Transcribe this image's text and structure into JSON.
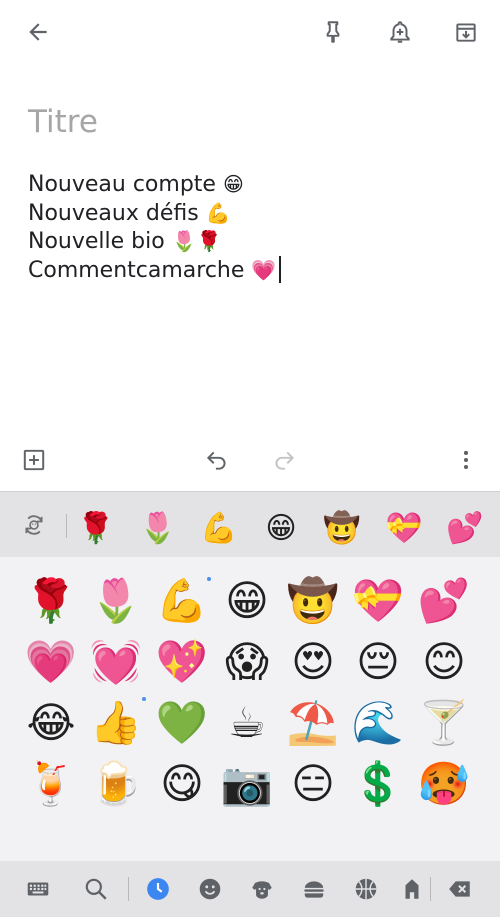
{
  "title_placeholder": "Titre",
  "note_lines": [
    {
      "text": "Nouveau compte",
      "emoji": "😁"
    },
    {
      "text": "Nouveaux défis",
      "emoji": "💪"
    },
    {
      "text": "Nouvelle bio",
      "emoji": "🌷🌹"
    },
    {
      "text": "Commentcamarche",
      "emoji": "💗"
    }
  ],
  "recent_emojis": [
    "🌹",
    "🌷",
    "💪",
    "😁",
    "🤠",
    "💝",
    "💕"
  ],
  "emoji_grid": [
    [
      "🌹",
      "🌷",
      "💪",
      "😁",
      "🤠",
      "💝",
      "💕"
    ],
    [
      "💗",
      "💓",
      "💖",
      "😱",
      "😍",
      "😔",
      "😊"
    ],
    [
      "😂",
      "👍",
      "💚",
      "☕",
      "⛱️",
      "🌊",
      "🍸"
    ],
    [
      "🍹",
      "🍺",
      "😋",
      "📷",
      "😑",
      "💲",
      "🥵"
    ]
  ],
  "colors": {
    "accent_blue": "#3b86f0",
    "keyboard_bg": "#f2f2f4",
    "keyboard_bar_bg": "#e3e3e5",
    "icon_gray": "#5f6368"
  },
  "icons": {
    "back": "arrow-back-icon",
    "pin": "pin-icon",
    "reminder": "bell-plus-icon",
    "archive": "archive-icon",
    "add_box": "add-box-icon",
    "undo": "undo-icon",
    "redo": "redo-icon",
    "more": "more-vert-icon",
    "emoji_mode_switch": "emoji-switch-icon",
    "keyboard": "keyboard-icon",
    "search": "search-icon",
    "recent": "clock-icon",
    "smileys": "smiley-icon",
    "animals": "dog-icon",
    "food": "burger-icon",
    "activities": "basketball-icon",
    "places": "building-icon",
    "backspace": "backspace-icon"
  }
}
